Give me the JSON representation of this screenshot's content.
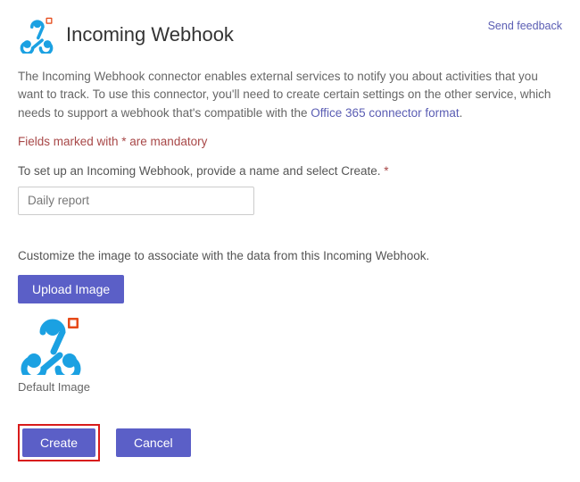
{
  "header": {
    "title": "Incoming Webhook",
    "feedback_link": "Send feedback"
  },
  "description": {
    "text_before_link": "The Incoming Webhook connector enables external services to notify you about activities that you want to track. To use this connector, you'll need to create certain settings on the other service, which needs to support a webhook that's compatible with the ",
    "link_text": "Office 365 connector format",
    "text_after_link": "."
  },
  "mandatory_note": "Fields marked with * are mandatory",
  "name_field": {
    "label": "To set up an Incoming Webhook, provide a name and select Create. ",
    "required_marker": "*",
    "value": "Daily report"
  },
  "image_section": {
    "customize_label": "Customize the image to associate with the data from this Incoming Webhook.",
    "upload_button": "Upload Image",
    "default_caption": "Default Image"
  },
  "actions": {
    "create": "Create",
    "cancel": "Cancel"
  },
  "icons": {
    "webhook": "webhook-icon"
  },
  "colors": {
    "accent": "#5b5fc7",
    "link": "#5a5db3",
    "warning": "#a84848",
    "highlight": "#d81b1b",
    "icon_blue": "#1ba1e2",
    "icon_orange": "#e64a19"
  }
}
